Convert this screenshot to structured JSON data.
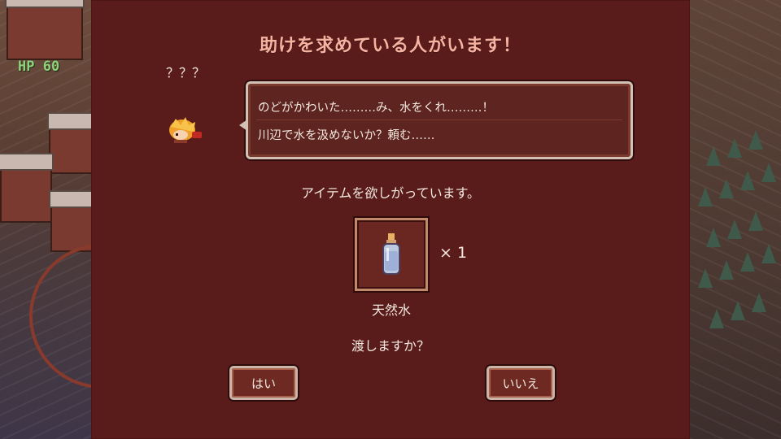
{
  "hud": {
    "hp_label": "HP 60"
  },
  "dialog": {
    "title": "助けを求めている人がいます！",
    "speaker": "？？？",
    "message_lines": [
      "のどがかわいた………み、水をくれ………！",
      "川辺で水を汲めないか？頼む……"
    ],
    "request_text": "アイテムを欲しがっています。",
    "item": {
      "name": "天然水",
      "quantity": "× 1",
      "icon": "water-bottle-icon"
    },
    "confirm_text": "渡しますか？",
    "yes_label": "はい",
    "no_label": "いいえ"
  },
  "colors": {
    "panel": "#5a1c1b",
    "title": "#f5b3a2",
    "text": "#f2e8e0",
    "frame": "#d2c2b5"
  }
}
